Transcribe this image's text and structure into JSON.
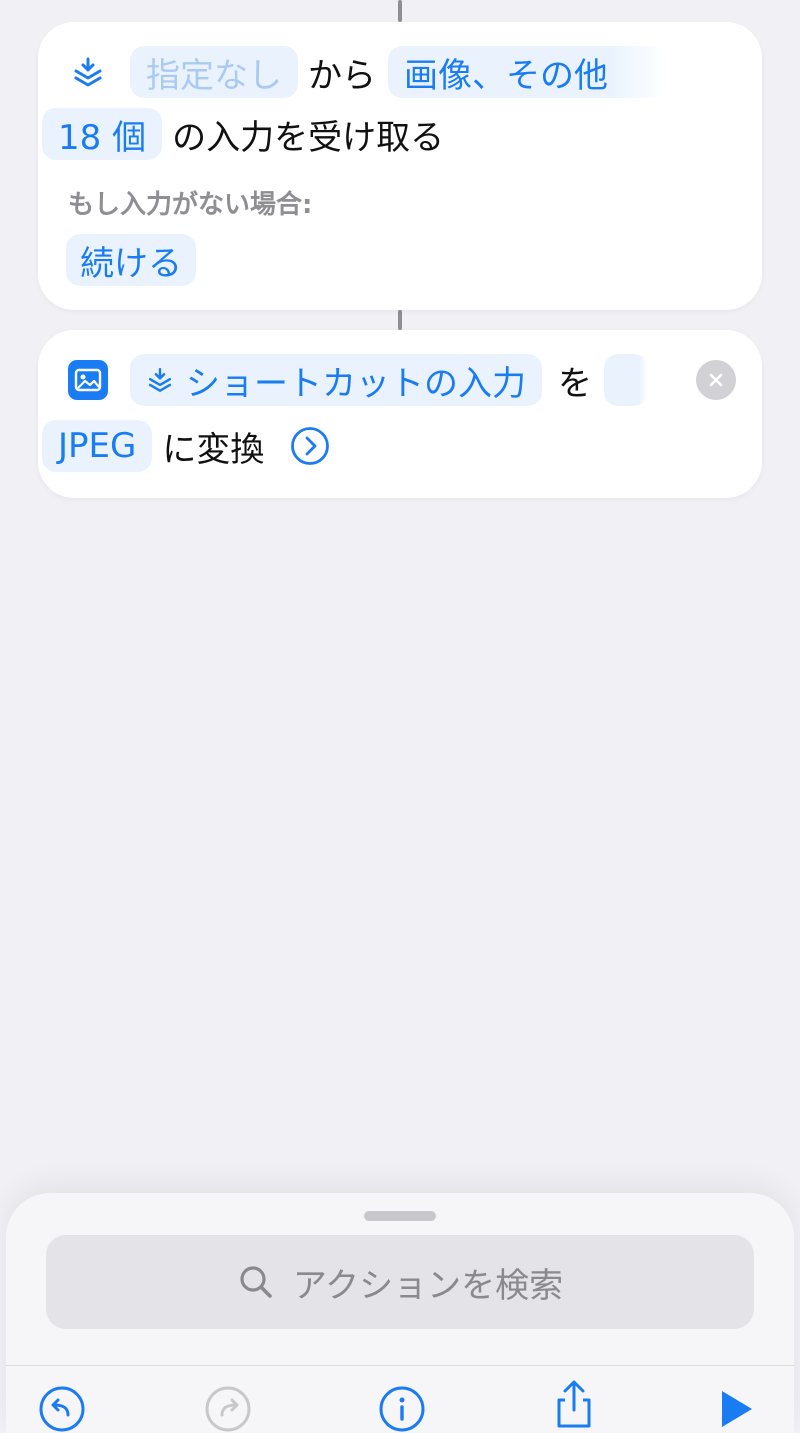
{
  "receive_action": {
    "source_token": "指定なし",
    "from_word": "から",
    "types_token": "画像、その他",
    "count_token": "18 個",
    "receive_text": "の入力を受け取る",
    "if_no_input_label": "もし入力がない場合:",
    "fallback_token": "続ける"
  },
  "convert_action": {
    "input_token": "ショートカットの入力",
    "particle": "を",
    "format_token": "JPEG",
    "convert_text": "に変換"
  },
  "bottom_sheet": {
    "search_placeholder": "アクションを検索"
  },
  "toolbar": {
    "items": [
      "undo-icon",
      "redo-icon",
      "info-icon",
      "share-icon",
      "play-icon"
    ]
  },
  "colors": {
    "accent": "#1a7cf3",
    "token_bg": "#eaf3fd",
    "background": "#f0f0f5"
  }
}
